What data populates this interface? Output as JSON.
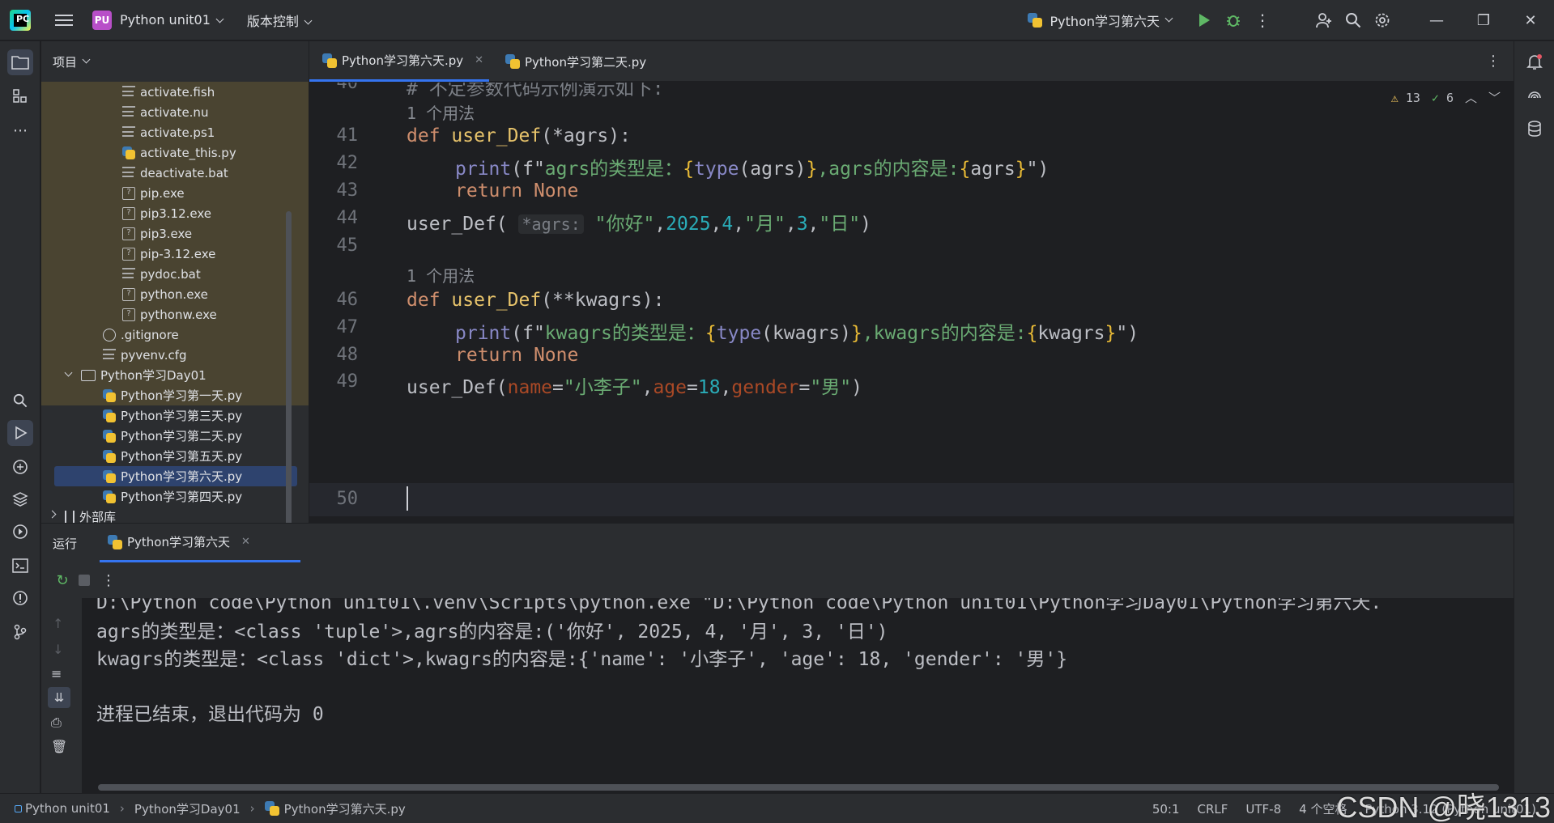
{
  "titlebar": {
    "logo_text": "PC",
    "project_badge": "PU",
    "project_name": "Python unit01",
    "vcs_menu": "版本控制",
    "run_config": "Python学习第六天",
    "icons": [
      "hamburger-menu-icon",
      "run-icon",
      "debug-icon",
      "more-vert-icon",
      "add-user-icon",
      "search-icon",
      "gear-icon",
      "minimize-icon",
      "maximize-icon",
      "close-icon"
    ]
  },
  "project_panel": {
    "title": "项目",
    "items": [
      {
        "label": "activate.fish",
        "icon": "text-file-icon"
      },
      {
        "label": "activate.nu",
        "icon": "text-file-icon"
      },
      {
        "label": "activate.ps1",
        "icon": "text-file-icon"
      },
      {
        "label": "activate_this.py",
        "icon": "python-file-icon"
      },
      {
        "label": "deactivate.bat",
        "icon": "text-file-icon"
      },
      {
        "label": "pip.exe",
        "icon": "unknown-file-icon"
      },
      {
        "label": "pip3.12.exe",
        "icon": "unknown-file-icon"
      },
      {
        "label": "pip3.exe",
        "icon": "unknown-file-icon"
      },
      {
        "label": "pip-3.12.exe",
        "icon": "unknown-file-icon"
      },
      {
        "label": "pydoc.bat",
        "icon": "text-file-icon"
      },
      {
        "label": "python.exe",
        "icon": "unknown-file-icon"
      },
      {
        "label": "pythonw.exe",
        "icon": "unknown-file-icon"
      },
      {
        "label": ".gitignore",
        "icon": "ignore-file-icon"
      },
      {
        "label": "pyvenv.cfg",
        "icon": "text-file-icon"
      },
      {
        "label": "Python学习Day01",
        "icon": "folder-icon"
      },
      {
        "label": "Python学习第一天.py",
        "icon": "python-file-icon"
      },
      {
        "label": "Python学习第三天.py",
        "icon": "python-file-icon"
      },
      {
        "label": "Python学习第二天.py",
        "icon": "python-file-icon"
      },
      {
        "label": "Python学习第五天.py",
        "icon": "python-file-icon"
      },
      {
        "label": "Python学习第六天.py",
        "icon": "python-file-icon",
        "selected": true
      },
      {
        "label": "Python学习第四天.py",
        "icon": "python-file-icon"
      },
      {
        "label": "外部库",
        "icon": "library-icon"
      }
    ]
  },
  "editor": {
    "tabs": [
      {
        "label": "Python学习第六天.py",
        "active": true
      },
      {
        "label": "Python学习第二天.py",
        "active": false
      }
    ],
    "inspections": {
      "warnings": "13",
      "ok": "6"
    },
    "usage_hint": "1 个用法",
    "line_numbers": [
      "40",
      "41",
      "42",
      "43",
      "44",
      "45",
      "46",
      "47",
      "48",
      "49",
      "50"
    ],
    "code": {
      "l40": "# 不定参数代码示例演示如下:",
      "l41_kw": "def",
      "l41_fn": "user_Def",
      "l41_rest": "(*agrs):",
      "l42_print": "print",
      "l42_a": "(f\"",
      "l42_b": "agrs的类型是：",
      "l42_c": "{",
      "l42_d": "type",
      "l42_e": "(agrs)",
      "l42_f": "}",
      "l42_g": ",agrs的内容是:",
      "l42_h": "{",
      "l42_i": "agrs",
      "l42_j": "}",
      "l42_k": "\")",
      "l43_kw": "return",
      "l43_none": "None",
      "l44_fn": "user_Def(",
      "l44_inlay": "*agrs:",
      "l44_s1": "\"你好\"",
      "l44_c1": ",",
      "l44_n1": "2025",
      "l44_c2": ",",
      "l44_n2": "4",
      "l44_c3": ",",
      "l44_s2": "\"月\"",
      "l44_c4": ",",
      "l44_n3": "3",
      "l44_c5": ",",
      "l44_s3": "\"日\"",
      "l44_end": ")",
      "l46_kw": "def",
      "l46_fn": "user_Def",
      "l46_rest": "(**kwagrs):",
      "l47_print": "print",
      "l47_a": "(f\"",
      "l47_b": "kwagrs的类型是：",
      "l47_c": "{",
      "l47_d": "type",
      "l47_e": "(kwagrs)",
      "l47_f": "}",
      "l47_g": ",kwagrs的内容是:",
      "l47_h": "{",
      "l47_i": "kwagrs",
      "l47_j": "}",
      "l47_k": "\")",
      "l48_kw": "return",
      "l48_none": "None",
      "l49_fn": "user_Def(",
      "l49_p1": "name",
      "l49_e1": "=",
      "l49_s1": "\"小李子\"",
      "l49_c1": ",",
      "l49_p2": "age",
      "l49_e2": "=",
      "l49_n1": "18",
      "l49_c2": ",",
      "l49_p3": "gender",
      "l49_e3": "=",
      "l49_s2": "\"男\"",
      "l49_end": ")"
    }
  },
  "run_panel": {
    "label": "运行",
    "tab": "Python学习第六天",
    "output": [
      "D:\\Python code\\Python unit01\\.venv\\Scripts\\python.exe \"D:\\Python code\\Python unit01\\Python学习Day01\\Python学习第六天.",
      "agrs的类型是：<class 'tuple'>,agrs的内容是:('你好', 2025, 4, '月', 3, '日')",
      "kwagrs的类型是：<class 'dict'>,kwagrs的内容是:{'name': '小李子', 'age': 18, 'gender': '男'}",
      "",
      "进程已结束，退出代码为 0"
    ]
  },
  "statusbar": {
    "crumbs": [
      "Python unit01",
      "Python学习Day01",
      "Python学习第六天.py"
    ],
    "position": "50:1",
    "line_sep": "CRLF",
    "encoding": "UTF-8",
    "indent": "4 个空格",
    "interpreter": "Python 3.12 (Python unit01)"
  },
  "watermark": "CSDN @晓1313",
  "colors": {
    "accent": "#3574f0",
    "keyword": "#cf8e6d",
    "string": "#6aab73",
    "number": "#2aacb8"
  }
}
